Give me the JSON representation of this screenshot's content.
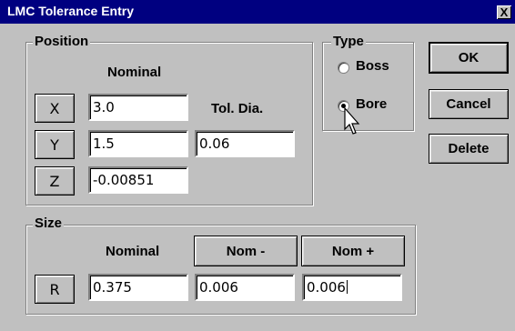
{
  "window": {
    "title": "LMC Tolerance Entry",
    "close_label": "X"
  },
  "position": {
    "legend": "Position",
    "nominal_label": "Nominal",
    "tol_label": "Tol. Dia.",
    "x": {
      "label": "X",
      "value": "3.0"
    },
    "y": {
      "label": "Y",
      "value": "1.5"
    },
    "z": {
      "label": "Z",
      "value": "-0.00851"
    },
    "tol_value": "0.06"
  },
  "type": {
    "legend": "Type",
    "options": [
      {
        "label": "Boss",
        "selected": false
      },
      {
        "label": "Bore",
        "selected": true
      }
    ]
  },
  "buttons": {
    "ok": "OK",
    "cancel": "Cancel",
    "delete": "Delete"
  },
  "size": {
    "legend": "Size",
    "nominal_label": "Nominal",
    "nom_minus_label": "Nom -",
    "nom_plus_label": "Nom +",
    "r": {
      "label": "R",
      "value": "0.375"
    },
    "nom_minus_value": "0.006",
    "nom_plus_value": "0.006"
  },
  "colors": {
    "titlebar": "#000080",
    "face": "#c0c0c0",
    "field": "#ffffff"
  },
  "icons": [
    "close-icon",
    "mouse-pointer-icon"
  ]
}
